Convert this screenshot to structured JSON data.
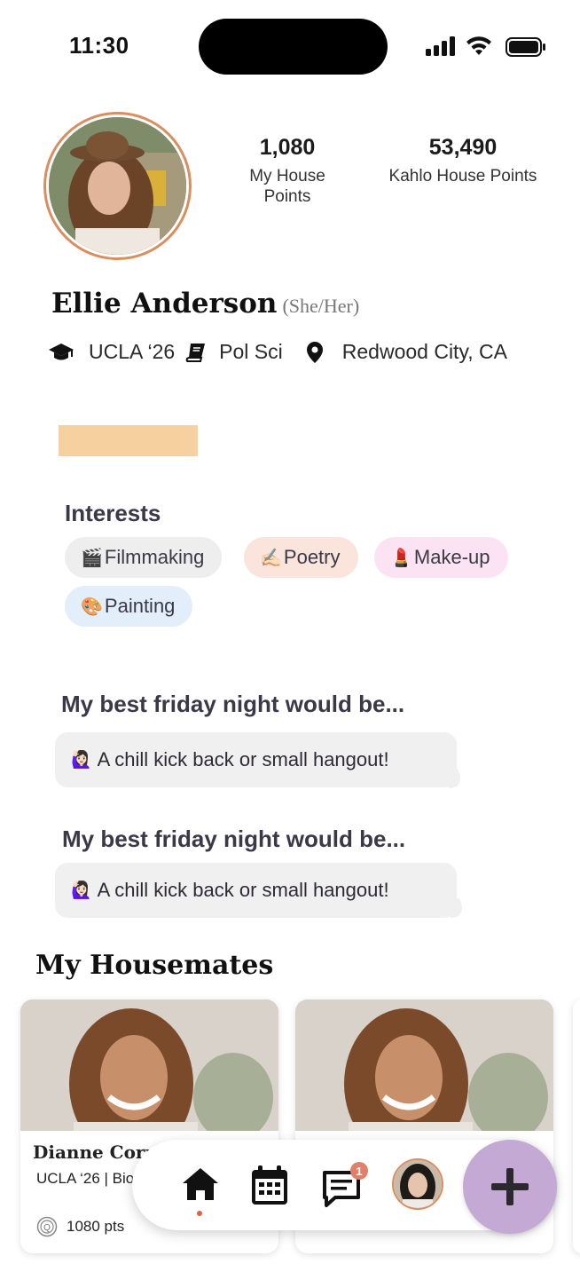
{
  "status_bar": {
    "time": "11:30"
  },
  "profile": {
    "my_points": "1,080",
    "my_points_label": "My House Points",
    "house_points": "53,490",
    "house_points_label": "Kahlo House Points",
    "name": "Ellie Anderson",
    "pronouns": "(She/Her)",
    "school": "UCLA ‘26",
    "major": "Pol Sci",
    "location": "Redwood City, CA"
  },
  "interests": {
    "title": "Interests",
    "chips": [
      {
        "emoji": "🎬",
        "label": "Filmmaking",
        "color": "#efeeee"
      },
      {
        "emoji": "✍🏻",
        "label": "Poetry",
        "color": "#fbe4dc"
      },
      {
        "emoji": "💄",
        "label": "Make-up",
        "color": "#fbe3f3"
      },
      {
        "emoji": "🎨",
        "label": "Painting",
        "color": "#e2effb"
      }
    ]
  },
  "prompts": [
    {
      "question": "My best friday night would be...",
      "emoji": "🙋🏻‍♀️",
      "answer": "A chill kick back or small hangout!"
    },
    {
      "question": "My best friday night would be...",
      "emoji": "🙋🏻‍♀️",
      "answer": "A chill kick back or small hangout!"
    }
  ],
  "housemates": {
    "title": "My Housemates",
    "cards": [
      {
        "name": "Dianne Corre",
        "sub": "UCLA ‘26 | Bio",
        "points": "1080 pts"
      },
      {
        "name": "",
        "sub": "",
        "points": ""
      }
    ]
  },
  "nav": {
    "items": [
      "home-icon",
      "calendar-icon",
      "chat-icon",
      "profile-avatar"
    ],
    "chat_badge": "1",
    "active_dot_color": "#e0603a",
    "fab_color": "#c3a9d4"
  }
}
